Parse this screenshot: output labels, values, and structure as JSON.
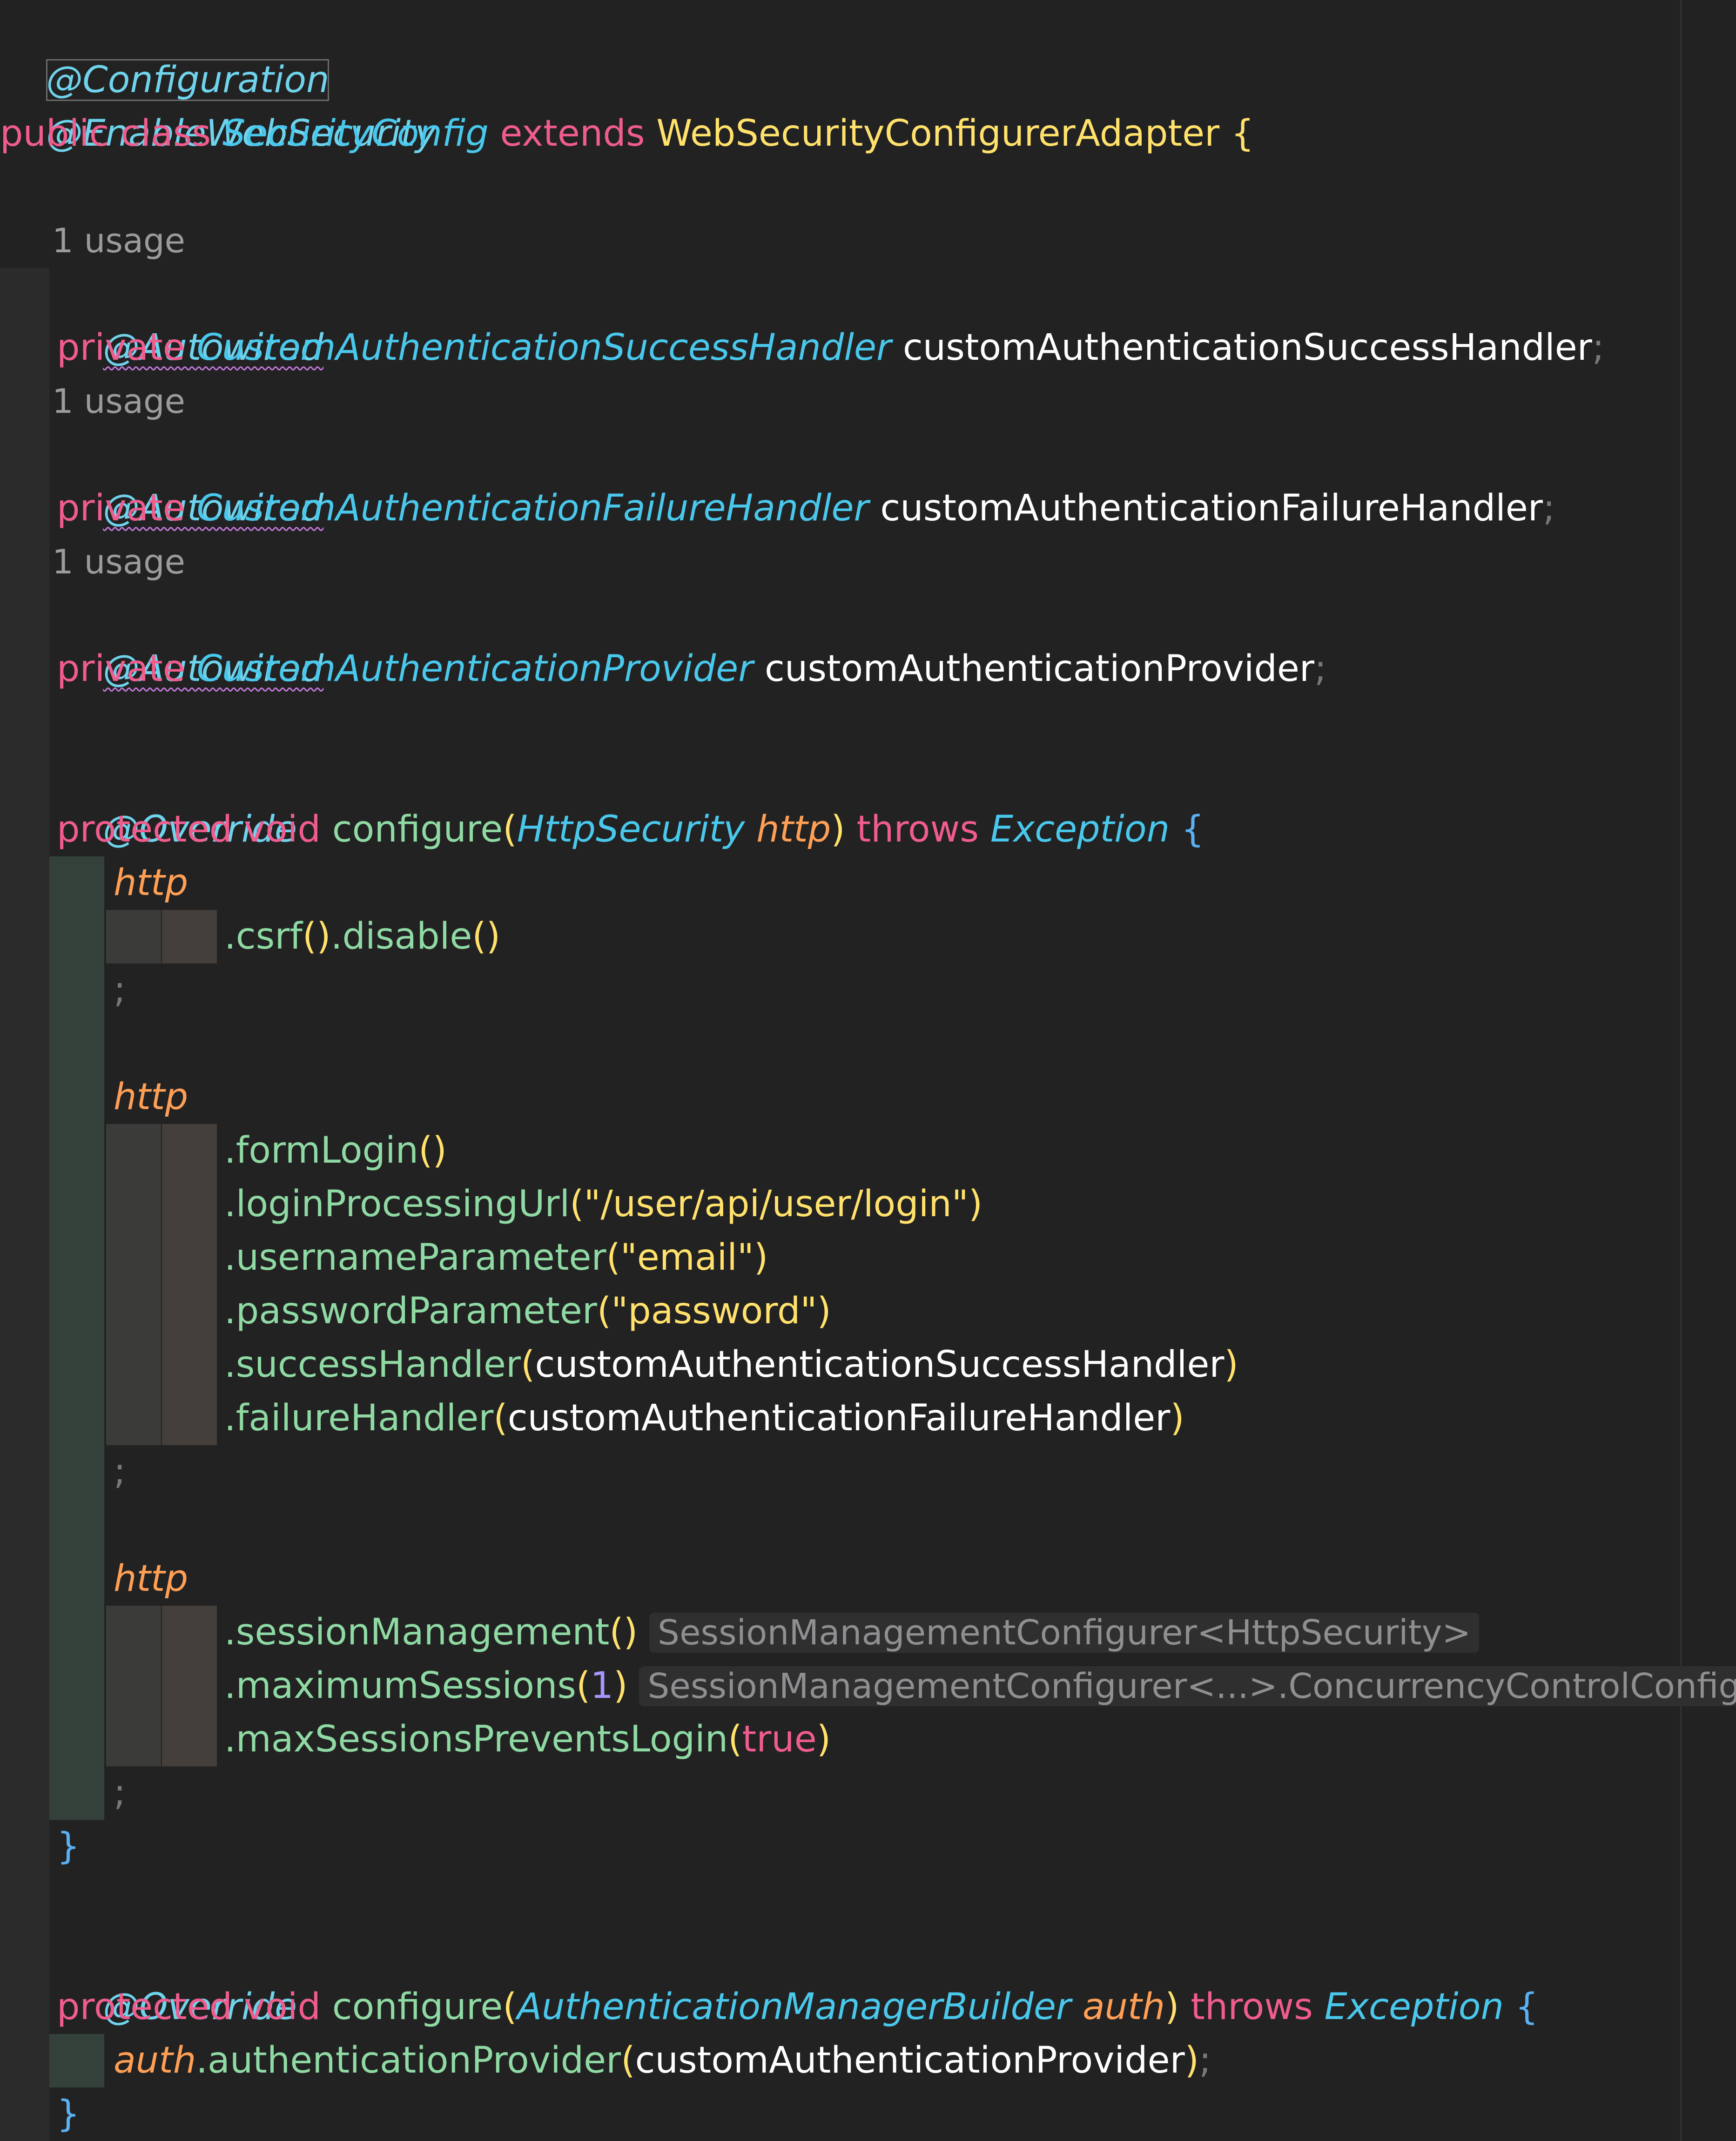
{
  "code": {
    "class_annotations": [
      "@Configuration",
      "@EnableWebSecurity"
    ],
    "class_decl": {
      "kw": "public class ",
      "name": "SecurityConfig",
      "ext": " extends ",
      "super": "WebSecurityConfigurerAdapter",
      "brace": " {"
    },
    "usage_label": "1 usage",
    "fields": [
      {
        "annotation": "@Autowired",
        "kw": "private ",
        "type": "CustomAuthenticationSuccessHandler",
        "name": " customAuthenticationSuccessHandler",
        "semi": ";"
      },
      {
        "annotation": "@Autowired",
        "kw": "private ",
        "type": "CustomAuthenticationFailureHandler",
        "name": " customAuthenticationFailureHandler",
        "semi": ";"
      },
      {
        "annotation": "@Autowired",
        "kw": "private ",
        "type": "CustomAuthenticationProvider",
        "name": " customAuthenticationProvider",
        "semi": ";"
      }
    ],
    "override": "@Override",
    "method1": {
      "kw": "protected void ",
      "name": "configure",
      "open": "(",
      "ptype": "HttpSecurity",
      "pname": " http",
      "close": ")",
      "throws": " throws ",
      "ex": "Exception",
      "brace": " {"
    },
    "http": "http",
    "semi": ";",
    "csrf": {
      "m1": ".csrf",
      "p1": "()",
      "m2": ".disable",
      "p2": "()"
    },
    "form": {
      "formLogin": ".formLogin",
      "formLogin_p": "()",
      "loginProcessingUrl": ".loginProcessingUrl",
      "loginProcessingUrl_arg": "(\"/user/api/user/login\")",
      "usernameParameter": ".usernameParameter",
      "usernameParameter_arg": "(\"email\")",
      "passwordParameter": ".passwordParameter",
      "passwordParameter_arg": "(\"password\")",
      "successHandler": ".successHandler",
      "successHandler_arg": "customAuthenticationSuccessHandler",
      "failureHandler": ".failureHandler",
      "failureHandler_arg": "customAuthenticationFailureHandler"
    },
    "session": {
      "sessionManagement": ".sessionManagement",
      "sessionManagement_p": "()",
      "hint1": "SessionManagementConfigurer<HttpSecurity>",
      "maximumSessions": ".maximumSessions",
      "maximumSessions_num": "1",
      "hint2": "SessionManagementConfigurer<...>.ConcurrencyControlConfigurer",
      "maxSessionsPreventsLogin": ".maxSessionsPreventsLogin",
      "maxSessionsPreventsLogin_arg": "true"
    },
    "close_brace": "}",
    "method2": {
      "kw": "protected void ",
      "name": "configure",
      "open": "(",
      "ptype": "AuthenticationManagerBuilder",
      "pname": " auth",
      "close": ")",
      "throws": " throws ",
      "ex": "Exception",
      "brace": " {"
    },
    "auth_line": {
      "obj": "auth",
      "method": ".authenticationProvider",
      "arg": "customAuthenticationProvider",
      "semi": ";"
    }
  },
  "colors": {
    "background": "#222223",
    "annotation": "#6fd3ec",
    "keyword": "#ef5c8d",
    "type": "#49c8ec",
    "class": "#ffe16b",
    "method": "#8fd9a3",
    "param": "#ff9f55",
    "string": "#ffe16b",
    "number": "#a895ff"
  }
}
